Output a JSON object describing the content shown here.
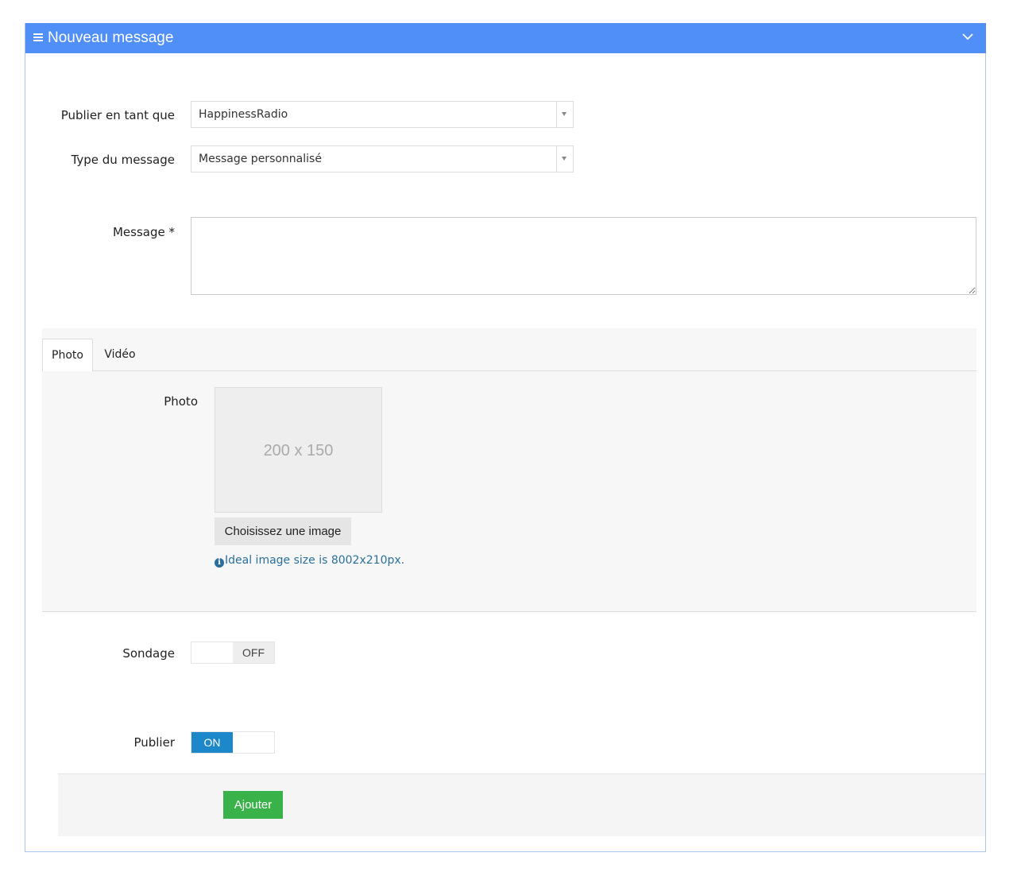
{
  "header": {
    "title": "Nouveau message"
  },
  "form": {
    "publish_as": {
      "label": "Publier en tant que",
      "value": "HappinessRadio"
    },
    "message_type": {
      "label": "Type du message",
      "value": "Message personnalisé"
    },
    "message": {
      "label": "Message *",
      "value": ""
    }
  },
  "tabs": [
    {
      "label": "Photo",
      "active": true
    },
    {
      "label": "Vidéo",
      "active": false
    }
  ],
  "photo": {
    "label": "Photo",
    "placeholder_text": "200 x 150",
    "choose_button": "Choisissez une image",
    "hint": "Ideal image size is 8002x210px.",
    "hint_icon": "info-icon"
  },
  "survey": {
    "label": "Sondage",
    "state": "OFF"
  },
  "publish": {
    "label": "Publier",
    "state": "ON"
  },
  "actions": {
    "add_button": "Ajouter"
  },
  "colors": {
    "header_bg": "#4f8ff7",
    "switch_on": "#1c87c9",
    "add_button": "#3ab24a",
    "hint_text": "#2a6f9c"
  }
}
